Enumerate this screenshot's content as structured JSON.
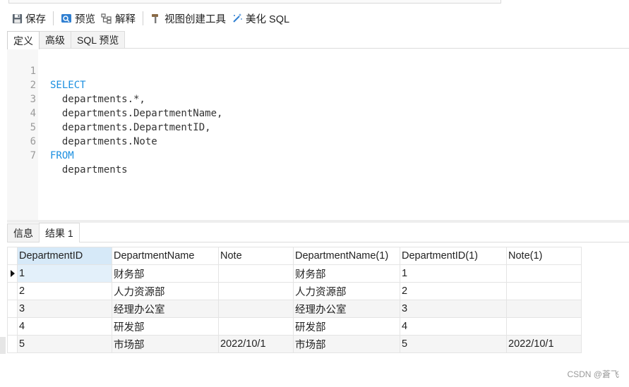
{
  "toolbar": {
    "save_label": "保存",
    "preview_label": "预览",
    "explain_label": "解释",
    "view_builder_label": "视图创建工具",
    "beautify_label": "美化 SQL"
  },
  "editor_tabs": [
    "定义",
    "高级",
    "SQL 预览"
  ],
  "editor": {
    "lines": [
      {
        "num": "1",
        "text": "SELECT",
        "keyword": true
      },
      {
        "num": "2",
        "text": "  departments.*,",
        "keyword": false
      },
      {
        "num": "3",
        "text": "  departments.DepartmentName,",
        "keyword": false
      },
      {
        "num": "4",
        "text": "  departments.DepartmentID,",
        "keyword": false
      },
      {
        "num": "5",
        "text": "  departments.Note",
        "keyword": false
      },
      {
        "num": "6",
        "text": "FROM",
        "keyword": true
      },
      {
        "num": "7",
        "text": "  departments",
        "keyword": false
      }
    ]
  },
  "result_tabs": [
    "信息",
    "结果 1"
  ],
  "result_grid": {
    "columns": [
      "DepartmentID",
      "DepartmentName",
      "Note",
      "DepartmentName(1)",
      "DepartmentID(1)",
      "Note(1)"
    ],
    "rows": [
      [
        "1",
        "财务部",
        "",
        "财务部",
        "1",
        ""
      ],
      [
        "2",
        "人力资源部",
        "",
        "人力资源部",
        "2",
        ""
      ],
      [
        "3",
        "经理办公室",
        "",
        "经理办公室",
        "3",
        ""
      ],
      [
        "4",
        "研发部",
        "",
        "研发部",
        "4",
        ""
      ],
      [
        "5",
        "市场部",
        "2022/10/1",
        "市场部",
        "5",
        "2022/10/1"
      ]
    ]
  },
  "watermark": "CSDN @蒼飞",
  "colors": {
    "keyword": "#1b8fe0",
    "selected_header": "#d6e9f8"
  }
}
